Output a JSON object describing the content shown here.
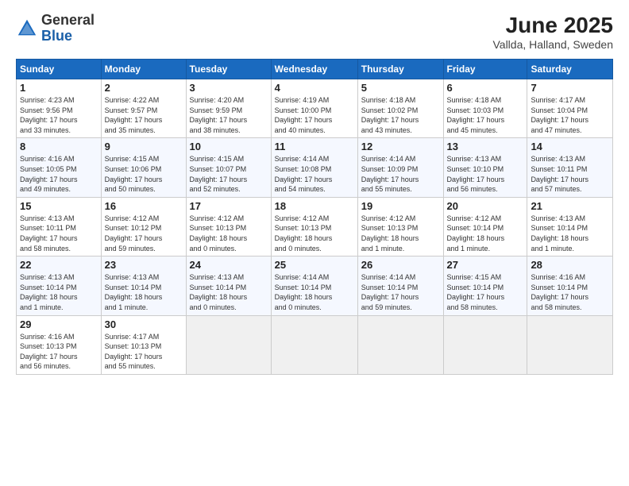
{
  "logo": {
    "general": "General",
    "blue": "Blue"
  },
  "title": "June 2025",
  "subtitle": "Vallda, Halland, Sweden",
  "headers": [
    "Sunday",
    "Monday",
    "Tuesday",
    "Wednesday",
    "Thursday",
    "Friday",
    "Saturday"
  ],
  "weeks": [
    [
      {
        "day": "1",
        "info": "Sunrise: 4:23 AM\nSunset: 9:56 PM\nDaylight: 17 hours\nand 33 minutes."
      },
      {
        "day": "2",
        "info": "Sunrise: 4:22 AM\nSunset: 9:57 PM\nDaylight: 17 hours\nand 35 minutes."
      },
      {
        "day": "3",
        "info": "Sunrise: 4:20 AM\nSunset: 9:59 PM\nDaylight: 17 hours\nand 38 minutes."
      },
      {
        "day": "4",
        "info": "Sunrise: 4:19 AM\nSunset: 10:00 PM\nDaylight: 17 hours\nand 40 minutes."
      },
      {
        "day": "5",
        "info": "Sunrise: 4:18 AM\nSunset: 10:02 PM\nDaylight: 17 hours\nand 43 minutes."
      },
      {
        "day": "6",
        "info": "Sunrise: 4:18 AM\nSunset: 10:03 PM\nDaylight: 17 hours\nand 45 minutes."
      },
      {
        "day": "7",
        "info": "Sunrise: 4:17 AM\nSunset: 10:04 PM\nDaylight: 17 hours\nand 47 minutes."
      }
    ],
    [
      {
        "day": "8",
        "info": "Sunrise: 4:16 AM\nSunset: 10:05 PM\nDaylight: 17 hours\nand 49 minutes."
      },
      {
        "day": "9",
        "info": "Sunrise: 4:15 AM\nSunset: 10:06 PM\nDaylight: 17 hours\nand 50 minutes."
      },
      {
        "day": "10",
        "info": "Sunrise: 4:15 AM\nSunset: 10:07 PM\nDaylight: 17 hours\nand 52 minutes."
      },
      {
        "day": "11",
        "info": "Sunrise: 4:14 AM\nSunset: 10:08 PM\nDaylight: 17 hours\nand 54 minutes."
      },
      {
        "day": "12",
        "info": "Sunrise: 4:14 AM\nSunset: 10:09 PM\nDaylight: 17 hours\nand 55 minutes."
      },
      {
        "day": "13",
        "info": "Sunrise: 4:13 AM\nSunset: 10:10 PM\nDaylight: 17 hours\nand 56 minutes."
      },
      {
        "day": "14",
        "info": "Sunrise: 4:13 AM\nSunset: 10:11 PM\nDaylight: 17 hours\nand 57 minutes."
      }
    ],
    [
      {
        "day": "15",
        "info": "Sunrise: 4:13 AM\nSunset: 10:11 PM\nDaylight: 17 hours\nand 58 minutes."
      },
      {
        "day": "16",
        "info": "Sunrise: 4:12 AM\nSunset: 10:12 PM\nDaylight: 17 hours\nand 59 minutes."
      },
      {
        "day": "17",
        "info": "Sunrise: 4:12 AM\nSunset: 10:13 PM\nDaylight: 18 hours\nand 0 minutes."
      },
      {
        "day": "18",
        "info": "Sunrise: 4:12 AM\nSunset: 10:13 PM\nDaylight: 18 hours\nand 0 minutes."
      },
      {
        "day": "19",
        "info": "Sunrise: 4:12 AM\nSunset: 10:13 PM\nDaylight: 18 hours\nand 1 minute."
      },
      {
        "day": "20",
        "info": "Sunrise: 4:12 AM\nSunset: 10:14 PM\nDaylight: 18 hours\nand 1 minute."
      },
      {
        "day": "21",
        "info": "Sunrise: 4:13 AM\nSunset: 10:14 PM\nDaylight: 18 hours\nand 1 minute."
      }
    ],
    [
      {
        "day": "22",
        "info": "Sunrise: 4:13 AM\nSunset: 10:14 PM\nDaylight: 18 hours\nand 1 minute."
      },
      {
        "day": "23",
        "info": "Sunrise: 4:13 AM\nSunset: 10:14 PM\nDaylight: 18 hours\nand 1 minute."
      },
      {
        "day": "24",
        "info": "Sunrise: 4:13 AM\nSunset: 10:14 PM\nDaylight: 18 hours\nand 0 minutes."
      },
      {
        "day": "25",
        "info": "Sunrise: 4:14 AM\nSunset: 10:14 PM\nDaylight: 18 hours\nand 0 minutes."
      },
      {
        "day": "26",
        "info": "Sunrise: 4:14 AM\nSunset: 10:14 PM\nDaylight: 17 hours\nand 59 minutes."
      },
      {
        "day": "27",
        "info": "Sunrise: 4:15 AM\nSunset: 10:14 PM\nDaylight: 17 hours\nand 58 minutes."
      },
      {
        "day": "28",
        "info": "Sunrise: 4:16 AM\nSunset: 10:14 PM\nDaylight: 17 hours\nand 58 minutes."
      }
    ],
    [
      {
        "day": "29",
        "info": "Sunrise: 4:16 AM\nSunset: 10:13 PM\nDaylight: 17 hours\nand 56 minutes."
      },
      {
        "day": "30",
        "info": "Sunrise: 4:17 AM\nSunset: 10:13 PM\nDaylight: 17 hours\nand 55 minutes."
      },
      {
        "day": "",
        "info": ""
      },
      {
        "day": "",
        "info": ""
      },
      {
        "day": "",
        "info": ""
      },
      {
        "day": "",
        "info": ""
      },
      {
        "day": "",
        "info": ""
      }
    ]
  ]
}
